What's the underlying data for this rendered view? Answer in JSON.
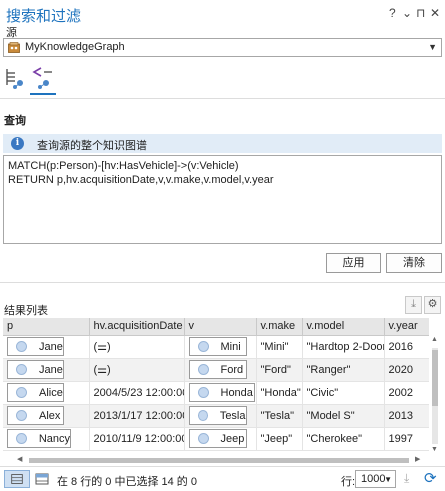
{
  "window": {
    "title": "搜索和过滤",
    "help": "?",
    "menu": "⌄",
    "pin": "⊓",
    "close": "✕"
  },
  "source": {
    "label": "源",
    "value": "MyKnowledgeGraph",
    "icon": "database-icon"
  },
  "tabs": [
    {
      "name": "filter-tab",
      "icon": "table-filter-icon"
    },
    {
      "name": "query-tab",
      "icon": "graph-query-icon",
      "active": true
    }
  ],
  "query": {
    "heading": "查询",
    "info": "查询源的整个知识图谱",
    "text": "MATCH(p:Person)-[hv:HasVehicle]->(v:Vehicle)\nRETURN p,hv.acquisitionDate,v,v.make,v.model,v.year",
    "apply_label": "应用",
    "clear_label": "清除"
  },
  "results": {
    "heading": "结果列表",
    "columns": [
      "p",
      "hv.acquisitionDate",
      "v",
      "v.make",
      "v.model",
      "v.year"
    ],
    "rows": [
      {
        "p": "Jane",
        "date": "",
        "v": "Mini",
        "make": "\"Mini\"",
        "model": "\"Hardtop 2-Door\"",
        "year": "2016"
      },
      {
        "p": "Jane",
        "date": "",
        "v": "Ford",
        "make": "\"Ford\"",
        "model": "\"Ranger\"",
        "year": "2020"
      },
      {
        "p": "Alice",
        "date": "2004/5/23 12:00:00",
        "v": "Honda",
        "make": "\"Honda\"",
        "model": "\"Civic\"",
        "year": "2002"
      },
      {
        "p": "Alex",
        "date": "2013/1/17 12:00:00",
        "v": "Tesla",
        "make": "\"Tesla\"",
        "model": "\"Model S\"",
        "year": "2013"
      },
      {
        "p": "Nancy",
        "date": "2010/11/9 12:00:00",
        "v": "Jeep",
        "make": "\"Jeep\"",
        "model": "\"Cherokee\"",
        "year": "1997"
      }
    ]
  },
  "status": {
    "text": "在 8 行的 0 中已选择 14 的 0",
    "rows_label": "行:",
    "rows_value": "1000"
  },
  "colors": {
    "accent": "#1e73be",
    "info_bg": "#e1ecf7"
  }
}
